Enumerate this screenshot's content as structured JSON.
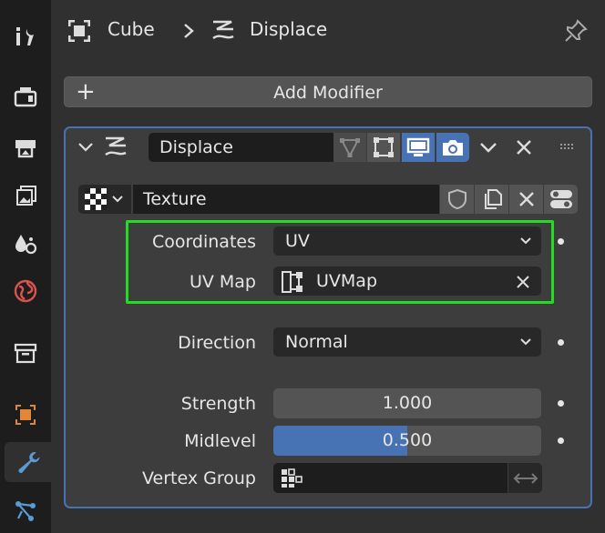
{
  "breadcrumb": {
    "object": "Cube",
    "modifier": "Displace"
  },
  "add_modifier_label": "Add Modifier",
  "modifier": {
    "name": "Displace",
    "texture": "Texture",
    "coordinates_label": "Coordinates",
    "coordinates_value": "UV",
    "uvmap_label": "UV Map",
    "uvmap_value": "UVMap",
    "direction_label": "Direction",
    "direction_value": "Normal",
    "strength_label": "Strength",
    "strength_value": "1.000",
    "midlevel_label": "Midlevel",
    "midlevel_value": "0.500",
    "midlevel_fraction": 0.5,
    "vertex_group_label": "Vertex Group"
  },
  "colors": {
    "accent": "#4772b3",
    "highlight": "#22dd22",
    "panel_bg": "#3d3d3d",
    "sidebar_bg": "#1d1d1d"
  },
  "sidebar_icons": [
    "tool-icon",
    "render-icon",
    "output-icon",
    "view-layer-icon",
    "scene-icon",
    "world-icon",
    "collection-icon",
    "object-icon",
    "modifier-icon",
    "particles-icon"
  ]
}
